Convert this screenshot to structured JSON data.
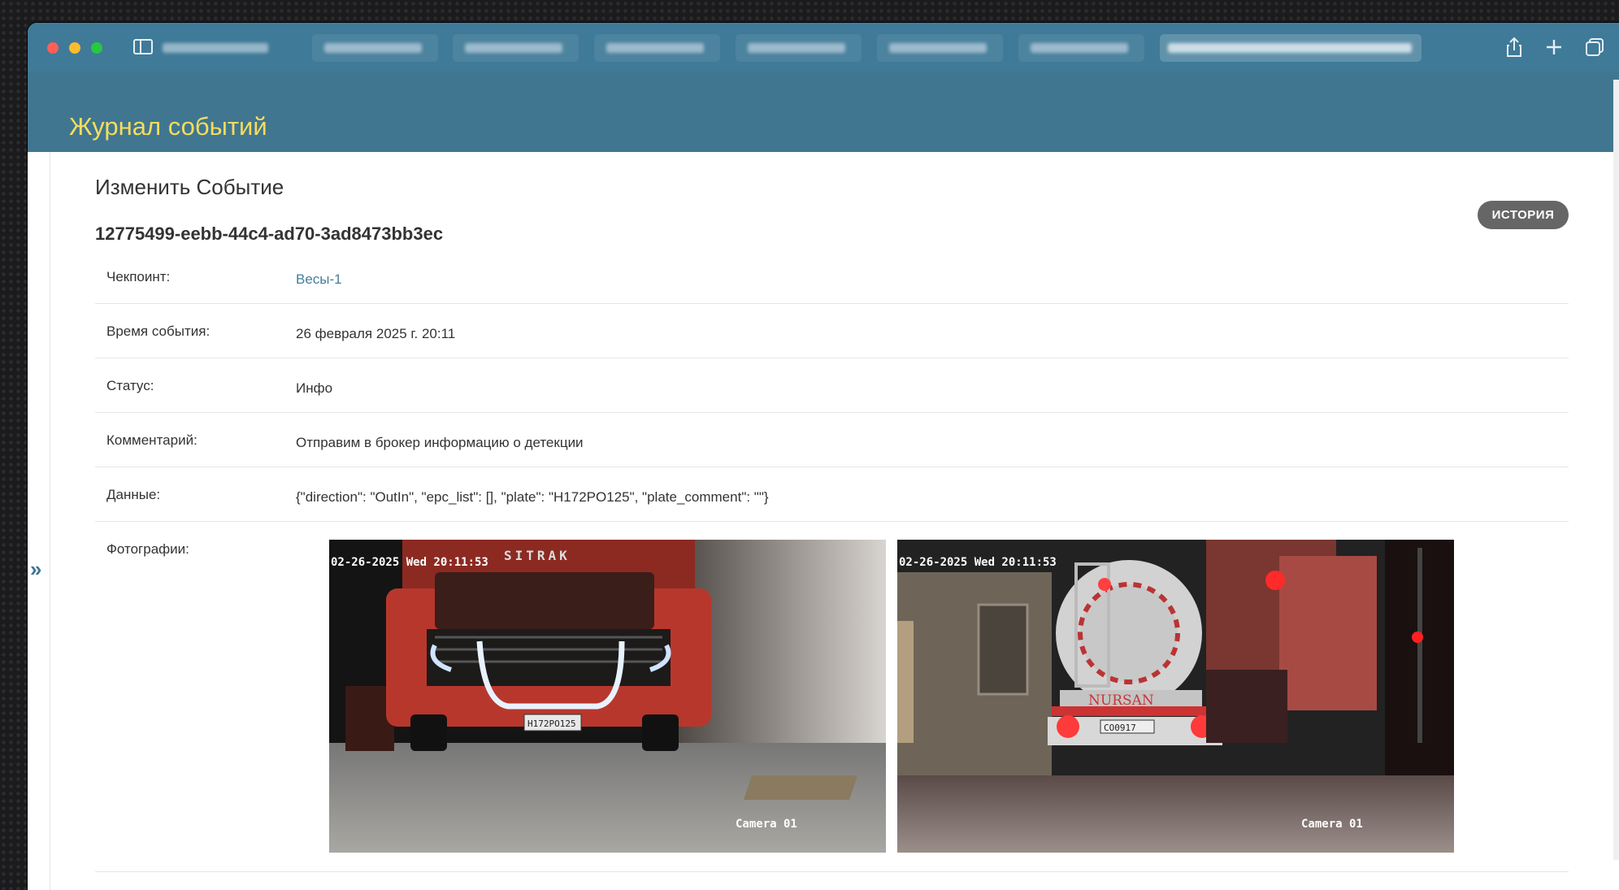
{
  "window": {
    "brand": "Журнал событий",
    "tab_count": 8
  },
  "page": {
    "title": "Изменить Событие",
    "object_id": "12775499-eebb-44c4-ad70-3ad8473bb3ec",
    "history_label": "ИСТОРИЯ"
  },
  "fields": {
    "checkpoint_label": "Чекпоинт:",
    "checkpoint_value": "Весы-1",
    "time_label": "Время события:",
    "time_value": "26 февраля 2025 г. 20:11",
    "status_label": "Статус:",
    "status_value": "Инфо",
    "comment_label": "Комментарий:",
    "comment_value": "Отправим в брокер информацию о детекции",
    "data_label": "Данные:",
    "data_value": "{\"direction\": \"OutIn\", \"epc_list\": [], \"plate\": \"H172PO125\", \"plate_comment\": \"\"}",
    "photos_label": "Фотографии:"
  },
  "photos": [
    {
      "timestamp": "02-26-2025 Wed 20:11:53",
      "camera": "Camera 01",
      "plate": "H172PO125",
      "brand_text": "SITRAK"
    },
    {
      "timestamp": "02-26-2025 Wed 20:11:53",
      "camera": "Camera 01",
      "plate": "CO0917",
      "brand_text": "NURSAN"
    }
  ],
  "icons": {
    "nav_toggle": "»",
    "share": "share-icon",
    "new_tab": "plus-icon",
    "tabs_overview": "tabs-icon"
  },
  "colors": {
    "header": "#417690",
    "brand": "#f5dd5d",
    "link": "#447e9b"
  }
}
